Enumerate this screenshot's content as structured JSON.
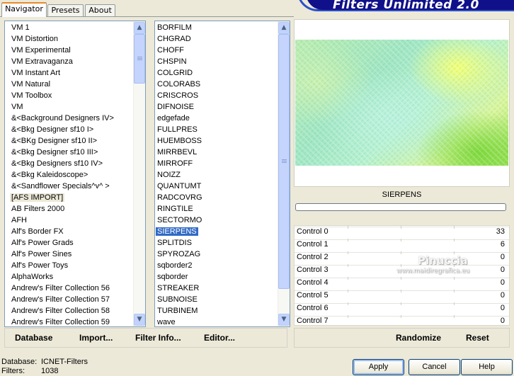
{
  "tabs": [
    {
      "label": "Navigator"
    },
    {
      "label": "Presets"
    },
    {
      "label": "About"
    }
  ],
  "brand": {
    "title": "Filters Unlimited 2.0"
  },
  "categories": {
    "items": [
      "VM 1",
      "VM Distortion",
      "VM Experimental",
      "VM Extravaganza",
      "VM Instant Art",
      "VM Natural",
      "VM Toolbox",
      "VM",
      "&<Background Designers IV>",
      "&<Bkg Designer sf10 I>",
      "&<BKg Designer sf10 II>",
      "&<Bkg Designer sf10 III>",
      "&<Bkg Designers sf10 IV>",
      "&<Bkg Kaleidoscope>",
      "&<Sandflower Specials^v^ >",
      "[AFS IMPORT]",
      "AB Filters 2000",
      "AFH",
      "Alf's Border FX",
      "Alf's Power Grads",
      "Alf's Power Sines",
      "Alf's Power Toys",
      "AlphaWorks",
      "Andrew's Filter Collection 56",
      "Andrew's Filter Collection 57",
      "Andrew's Filter Collection 58",
      "Andrew's Filter Collection 59"
    ],
    "highlighted": "[AFS IMPORT]"
  },
  "filters": {
    "items": [
      "BORFILM",
      "CHGRAD",
      "CHOFF",
      "CHSPIN",
      "COLGRID",
      "COLORABS",
      "CRISCROS",
      "DIFNOISE",
      "edgefade",
      "FULLPRES",
      "HUEMBOSS",
      "MIRRBEVL",
      "MIRROFF",
      "NOIZZ",
      "QUANTUMT",
      "RADCOVRG",
      "RINGTILE",
      "SECTORMO",
      "SIERPENS",
      "SPLITDIS",
      "SPYROZAG",
      "sqborder2",
      "sqborder",
      "STREAKER",
      "SUBNOISE",
      "TURBINEM",
      "wave"
    ],
    "selected": "SIERPENS"
  },
  "preview": {
    "filter_name": "SIERPENS",
    "progress": 0
  },
  "controls": [
    {
      "label": "Control 0",
      "value": "33"
    },
    {
      "label": "Control 1",
      "value": "6"
    },
    {
      "label": "Control 2",
      "value": "0"
    },
    {
      "label": "Control 3",
      "value": "0"
    },
    {
      "label": "Control 4",
      "value": "0"
    },
    {
      "label": "Control 5",
      "value": "0"
    },
    {
      "label": "Control 6",
      "value": "0"
    },
    {
      "label": "Control 7",
      "value": "0"
    }
  ],
  "left_buttons": {
    "database": "Database",
    "import": "Import...",
    "filter_info": "Filter Info...",
    "editor": "Editor..."
  },
  "right_buttons": {
    "randomize": "Randomize",
    "reset": "Reset"
  },
  "status": {
    "database_label": "Database:",
    "database_value": "ICNET-Filters",
    "filters_label": "Filters:",
    "filters_value": "1038"
  },
  "dialog_buttons": {
    "apply": "Apply",
    "cancel": "Cancel",
    "help": "Help"
  },
  "watermark": {
    "line1": "Pinuccia",
    "line2": "www.maidiregrafica.eu"
  }
}
